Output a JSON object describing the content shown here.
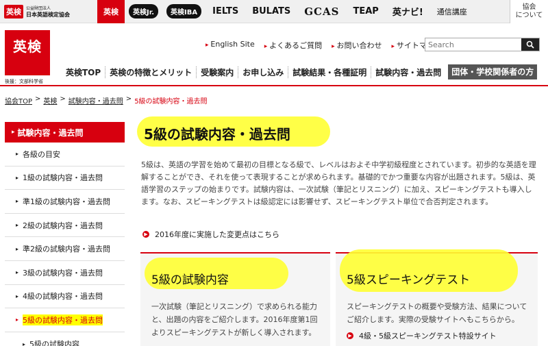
{
  "topbar": {
    "org_mark": "英検",
    "org_line1": "公益財団法人",
    "org_line2": "日本英語検定協会",
    "brands": [
      {
        "label": "英検",
        "active": true
      },
      {
        "label": "英検Jr.",
        "style": "pill"
      },
      {
        "label": "英検IBA",
        "style": "pill"
      },
      {
        "label": "IELTS"
      },
      {
        "label": "BULATS"
      },
      {
        "label": "GCAS",
        "style": "serif"
      },
      {
        "label": "TEAP"
      },
      {
        "label": "英ナビ!"
      },
      {
        "label": "通信講座",
        "style": "small"
      }
    ],
    "about_line1": "協会",
    "about_line2": "について"
  },
  "header": {
    "logo": "英検",
    "logo_sub": "後援：文部科学省",
    "util_links": [
      "English Site",
      "よくあるご質問",
      "お問い合わせ",
      "サイトマップ"
    ],
    "search_placeholder": "Search",
    "nav": [
      "英検TOP",
      "英検の特徴とメリット",
      "受験案内",
      "お申し込み",
      "試験結果・各種証明",
      "試験内容・過去問",
      "団体・学校関係者の方"
    ]
  },
  "breadcrumb": [
    "協会TOP",
    "英検",
    "試験内容・過去問",
    "5級の試験内容・過去問"
  ],
  "sidebar": {
    "heading": "試験内容・過去問",
    "items": [
      "各級の目安",
      "1級の試験内容・過去問",
      "準1級の試験内容・過去問",
      "2級の試験内容・過去問",
      "準2級の試験内容・過去問",
      "3級の試験内容・過去問",
      "4級の試験内容・過去問",
      "5級の試験内容・過去問",
      "5級の試験内容"
    ]
  },
  "main": {
    "title": "5級の試験内容・過去問",
    "intro": "5級は、英語の学習を始めて最初の目標となる級で、レベルはおよそ中学初級程度とされています。初歩的な英語を理解することができ、それを使って表現することが求められます。基礎的でかつ重要な内容が出題されます。5級は、英語学習のステップの始まりです。試験内容は、一次試験（筆記とリスニング）に加え、スピーキングテストも導入します。なお、スピーキングテストは級認定には影響せず、スピーキングテスト単位で合否判定されます。",
    "notice": "2016年度に実施した変更点はこちら",
    "cards": [
      {
        "title": "5級の試験内容",
        "text": "一次試験（筆記とリスニング）で求められる能力と、出題の内容をご紹介します。2016年度第1回よりスピーキングテストが新しく導入されます。",
        "link": ""
      },
      {
        "title": "5級スピーキングテスト",
        "text": "スピーキングテストの概要や受験方法、結果についてご紹介します。実際の受験サイトへもこちらから。",
        "link": "4級・5級スピーキングテスト特設サイト"
      }
    ]
  },
  "colors": {
    "accent": "#d7000f",
    "highlight": "#ffff33"
  }
}
